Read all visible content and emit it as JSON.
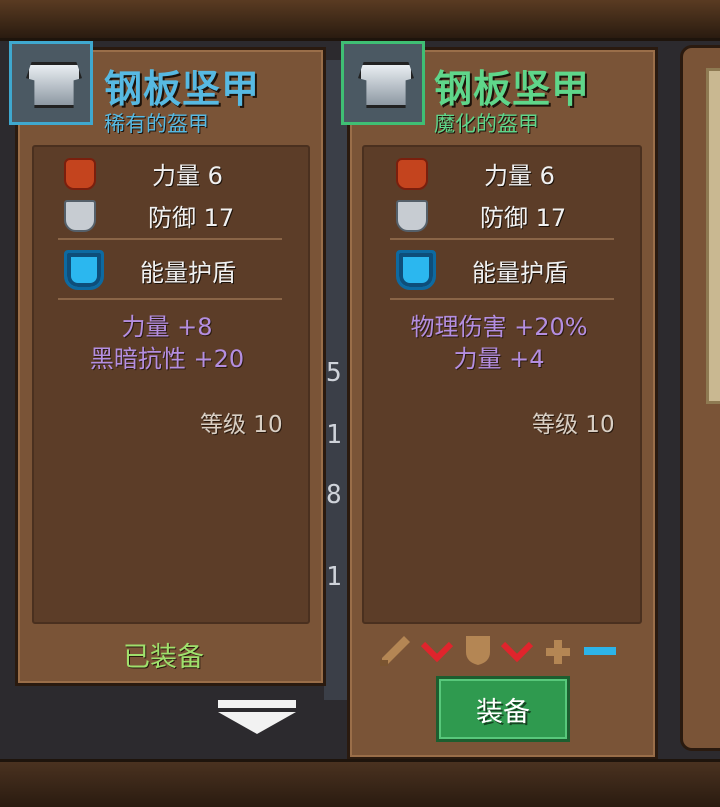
{
  "left_card": {
    "title": "钢板坚甲",
    "subtitle": "稀有的盔甲",
    "title_color": "#57b9e2",
    "frame_color": "#3fa8cf",
    "stats": [
      {
        "icon": "fist-icon",
        "label": "力量 6"
      },
      {
        "icon": "shield-icon",
        "label": "防御 17"
      }
    ],
    "ability": "能量护盾",
    "bonuses": [
      "力量 +8",
      "黑暗抗性 +20"
    ],
    "level": "等级 10",
    "status": "已装备"
  },
  "right_card": {
    "title": "钢板坚甲",
    "subtitle": "魔化的盔甲",
    "title_color": "#5fd68a",
    "frame_color": "#3fbf74",
    "stats": [
      {
        "icon": "fist-icon",
        "label": "力量 6"
      },
      {
        "icon": "shield-icon",
        "label": "防御 17"
      }
    ],
    "ability": "能量护盾",
    "bonuses": [
      "物理伤害 +20%",
      "力量 +4"
    ],
    "level": "等级 10",
    "equip_button": "装备",
    "compare_icons": [
      "sword-icon",
      "down-red-icon",
      "shield-icon",
      "down-red-icon",
      "plus-icon",
      "minus-icon"
    ]
  },
  "background_numbers": [
    "5",
    "1",
    "8",
    "1"
  ]
}
